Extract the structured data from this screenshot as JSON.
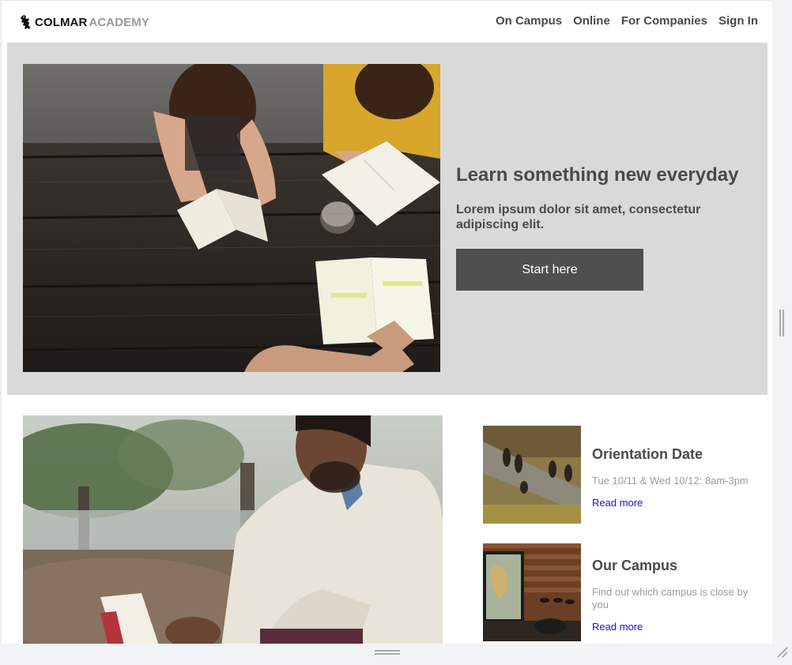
{
  "header": {
    "logo_primary": "COLMAR",
    "logo_secondary": "ACADEMY",
    "logo_icon": "lion-rampant-icon",
    "nav": [
      {
        "label": "On Campus"
      },
      {
        "label": "Online"
      },
      {
        "label": "For Companies"
      },
      {
        "label": "Sign In"
      }
    ]
  },
  "hero": {
    "title": "Learn something new everyday",
    "subtitle": "Lorem ipsum dolor sit amet, consectetur adipiscing elit.",
    "cta_label": "Start here",
    "image": "students-studying-at-picnic-table-photo",
    "background": "#d9d9d9",
    "cta_color": "#4f4f4f"
  },
  "feature": {
    "image": "man-reading-book-outdoors-photo"
  },
  "cards": [
    {
      "title": "Orientation Date",
      "description": "Tue 10/11 & Wed 10/12: 8am-3pm",
      "link": "Read more",
      "image": "people-walking-aerial-photo"
    },
    {
      "title": "Our Campus",
      "description": "Find out which campus is close by you",
      "link": "Read more",
      "image": "campus-interior-with-map-photo"
    }
  ],
  "colors": {
    "text": "#4a4a4a",
    "muted": "#9b9b9b",
    "link": "#1a12cc"
  }
}
